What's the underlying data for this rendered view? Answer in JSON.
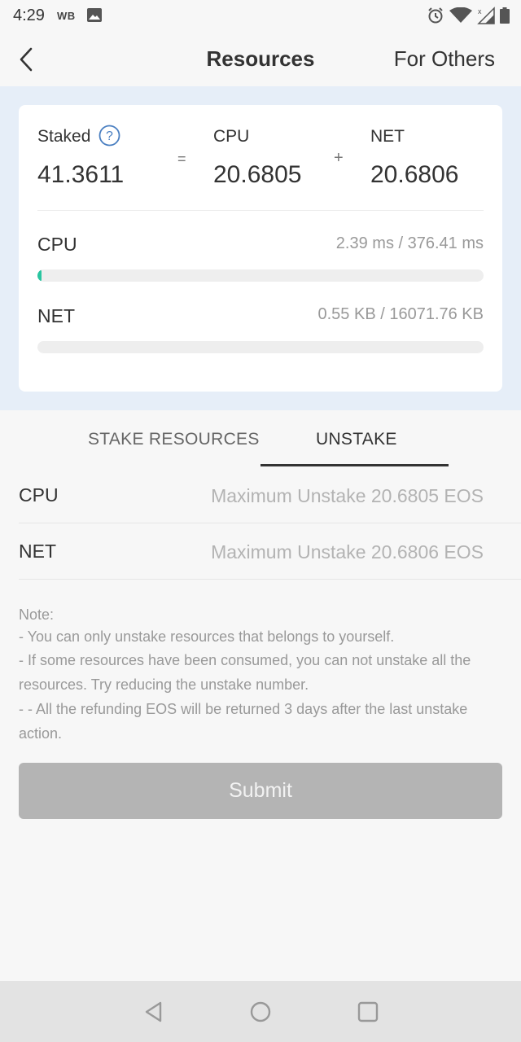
{
  "status_bar": {
    "time": "4:29",
    "carrier": "WB",
    "icons": [
      "image-icon",
      "alarm-icon",
      "wifi-icon",
      "signal-icon",
      "battery-icon"
    ]
  },
  "header": {
    "back_icon": "chevron-left-icon",
    "title": "Resources",
    "right_action": "For Others"
  },
  "summary": {
    "staked_label": "Staked",
    "staked_value": "41.3611",
    "equals": "=",
    "cpu_label": "CPU",
    "cpu_value": "20.6805",
    "plus": "+",
    "net_label": "NET",
    "net_value": "20.6806",
    "help_icon": "question-circle-icon"
  },
  "usage": {
    "cpu": {
      "label": "CPU",
      "text": "2.39 ms / 376.41 ms",
      "fraction": 0.0063
    },
    "net": {
      "label": "NET",
      "text": "0.55 KB / 16071.76 KB",
      "fraction": 3e-05
    }
  },
  "tabs": {
    "items": [
      "STAKE RESOURCES",
      "UNSTAKE"
    ],
    "active": "UNSTAKE"
  },
  "form": {
    "cpu_label": "CPU",
    "cpu_placeholder": "Maximum Unstake 20.6805 EOS",
    "cpu_value": "",
    "net_label": "NET",
    "net_placeholder": "Maximum Unstake 20.6806 EOS",
    "net_value": ""
  },
  "notes": {
    "heading": "Note:",
    "line1": "- You can only unstake resources that belongs to yourself.",
    "line2": "- If some resources have been consumed, you can not unstake all the resources. Try reducing the unstake number.",
    "line3": "- - All the refunding EOS will be returned 3 days after the last unstake action."
  },
  "submit_label": "Submit",
  "colors": {
    "accent": "#29c5a0",
    "summary_bg": "#e6eef8",
    "submit_disabled": "#b4b4b4",
    "help_icon": "#4a7fc1"
  },
  "nav_icons": [
    "back-triangle-icon",
    "home-circle-icon",
    "recents-square-icon"
  ]
}
